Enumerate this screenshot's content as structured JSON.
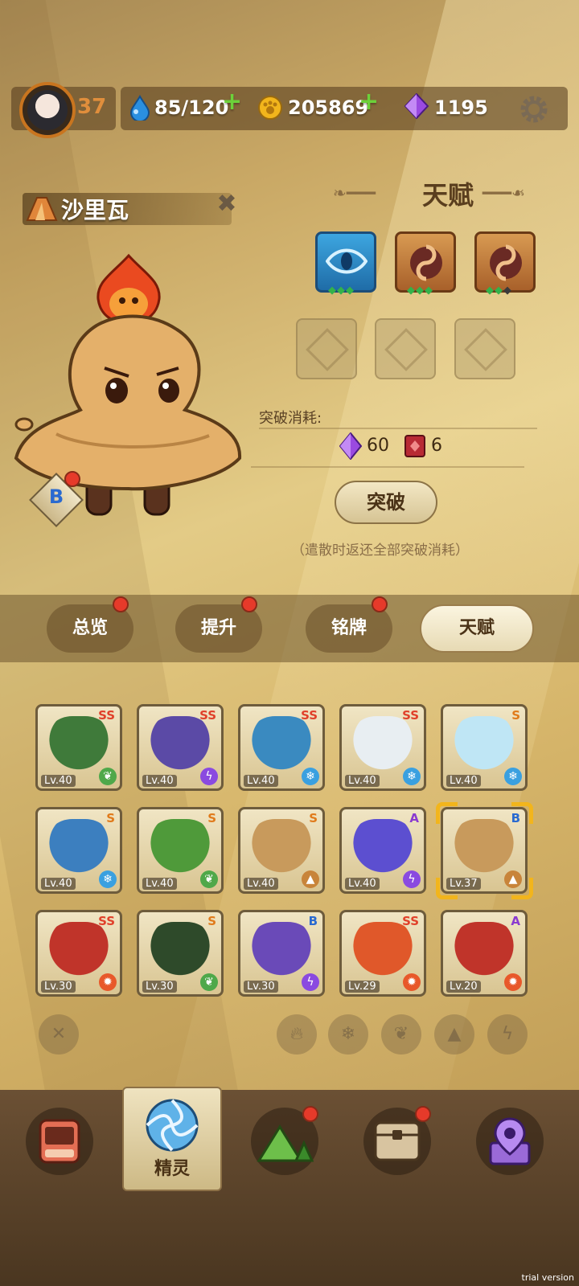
{
  "player": {
    "level": "37"
  },
  "resources": {
    "water": "85/120",
    "gold": "205869",
    "gems": "1195",
    "water_icon": "water-drop-icon",
    "gold_icon": "paw-coin-icon",
    "gem_icon": "purple-crystal-icon"
  },
  "pet": {
    "name": "沙里瓦",
    "grade": "B",
    "element_icon": "earth-mountain-icon"
  },
  "talent": {
    "title": "天赋",
    "cost_label": "突破消耗:",
    "cost_gems": "60",
    "cost_books": "6",
    "break_button": "突破",
    "note": "（遣散时返还全部突破消耗）"
  },
  "tabs": [
    {
      "label": "总览",
      "active": false,
      "badge": true
    },
    {
      "label": "提升",
      "active": false,
      "badge": true
    },
    {
      "label": "铭牌",
      "active": false,
      "badge": true
    },
    {
      "label": "天赋",
      "active": true,
      "badge": false
    }
  ],
  "cards": [
    {
      "lv": "Lv.40",
      "grade": "SS",
      "element": "leaf",
      "color": "#3f7a3a"
    },
    {
      "lv": "Lv.40",
      "grade": "SS",
      "element": "lightning",
      "color": "#5b4aa6"
    },
    {
      "lv": "Lv.40",
      "grade": "SS",
      "element": "ice",
      "color": "#3a8ac0"
    },
    {
      "lv": "Lv.40",
      "grade": "SS",
      "element": "ice",
      "color": "#e8eef2"
    },
    {
      "lv": "Lv.40",
      "grade": "S",
      "element": "ice",
      "color": "#bfe6f5"
    },
    {
      "lv": "Lv.40",
      "grade": "S",
      "element": "ice",
      "color": "#3c7fbf"
    },
    {
      "lv": "Lv.40",
      "grade": "S",
      "element": "leaf",
      "color": "#4f9a3a"
    },
    {
      "lv": "Lv.40",
      "grade": "S",
      "element": "earth",
      "color": "#c89a5c"
    },
    {
      "lv": "Lv.40",
      "grade": "A",
      "element": "lightning",
      "color": "#5c4fd0"
    },
    {
      "lv": "Lv.37",
      "grade": "B",
      "element": "earth",
      "color": "#c89a5c"
    },
    {
      "lv": "Lv.30",
      "grade": "SS",
      "element": "fire",
      "color": "#c0342a"
    },
    {
      "lv": "Lv.30",
      "grade": "S",
      "element": "leaf",
      "color": "#2e4a2a"
    },
    {
      "lv": "Lv.30",
      "grade": "B",
      "element": "lightning",
      "color": "#6a4ab8"
    },
    {
      "lv": "Lv.29",
      "grade": "SS",
      "element": "fire",
      "color": "#e0582a"
    },
    {
      "lv": "Lv.20",
      "grade": "A",
      "element": "fire",
      "color": "#c0342a"
    }
  ],
  "element_colors": {
    "leaf": "#4fa84a",
    "lightning": "#8a4ae0",
    "ice": "#3aa0e0",
    "earth": "#c8843a",
    "fire": "#e8582a"
  },
  "grade_colors": {
    "SS": "#e0402a",
    "S": "#e07a1a",
    "A": "#8a3ad0",
    "B": "#2a6ad0"
  },
  "filters": [
    "clear-filter-icon",
    "fire-icon",
    "ice-icon",
    "leaf-icon",
    "earth-icon",
    "lightning-icon"
  ],
  "nav": [
    {
      "icon": "bag-icon",
      "badge": false
    },
    {
      "icon": "spirit-swirl-icon",
      "label": "精灵",
      "active": true
    },
    {
      "icon": "mountain-icon",
      "badge": true
    },
    {
      "icon": "chest-icon",
      "badge": true
    },
    {
      "icon": "map-pin-icon",
      "badge": false
    }
  ],
  "watermark": "trial version"
}
